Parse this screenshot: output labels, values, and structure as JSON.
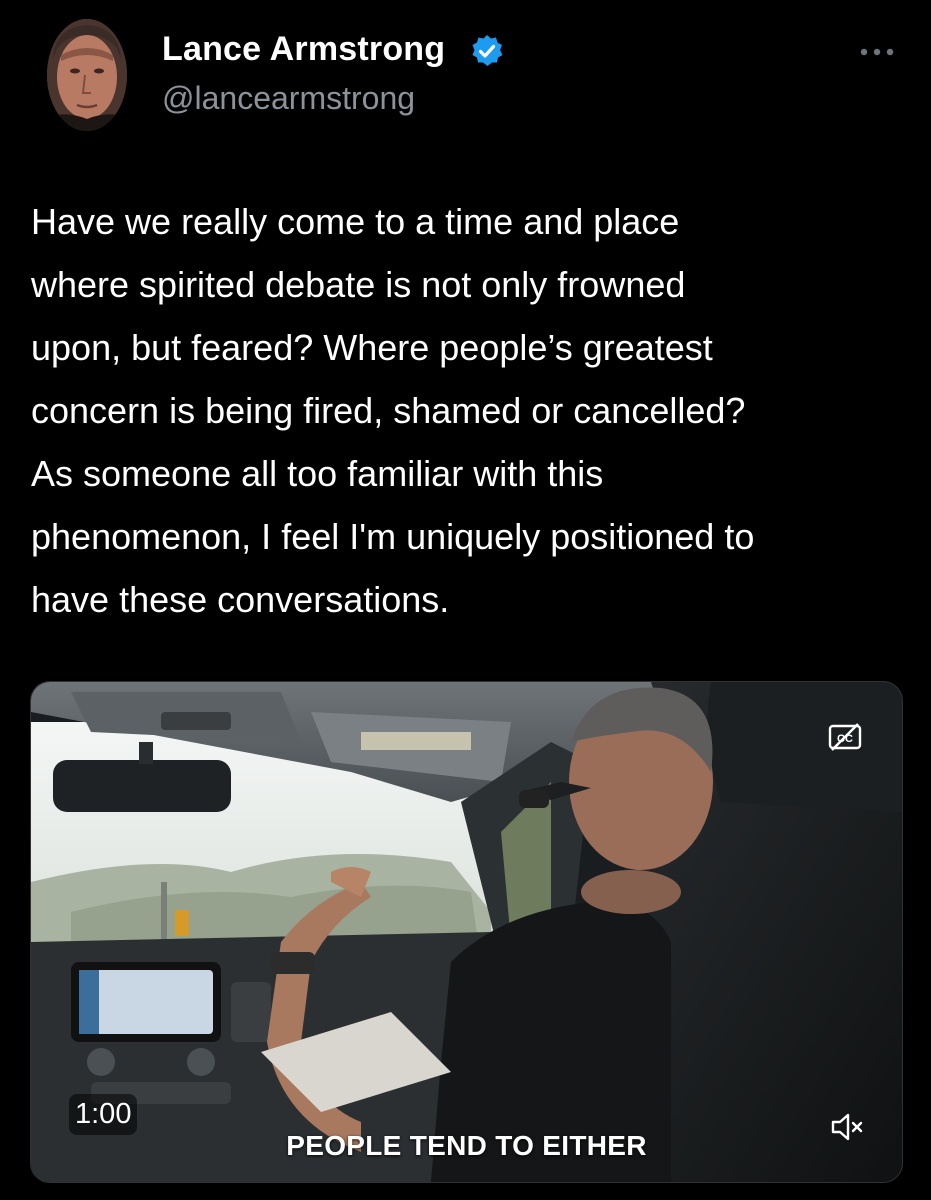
{
  "tweet": {
    "author": {
      "display_name": "Lance Armstrong",
      "handle": "@lancearmstrong",
      "verified": true,
      "avatar_icon": "profile-photo"
    },
    "more_icon": "ellipsis-icon",
    "text_lines": [
      "Have we really come to a time and place",
      "where spirited debate is not only frowned",
      "upon, but feared? Where people’s greatest",
      "concern is being fired, shamed or cancelled?",
      "As someone all too familiar with this",
      "phenomenon, I feel I'm uniquely positioned to",
      "have these conversations."
    ]
  },
  "video": {
    "duration": "1:00",
    "caption": "PEOPLE TEND TO EITHER",
    "cc_icon": "closed-captions-off-icon",
    "mute_icon": "volume-muted-icon"
  },
  "colors": {
    "background": "#000000",
    "text": "#ffffff",
    "secondary_text": "#8b9299",
    "verified_badge": "#1d9bf0"
  }
}
